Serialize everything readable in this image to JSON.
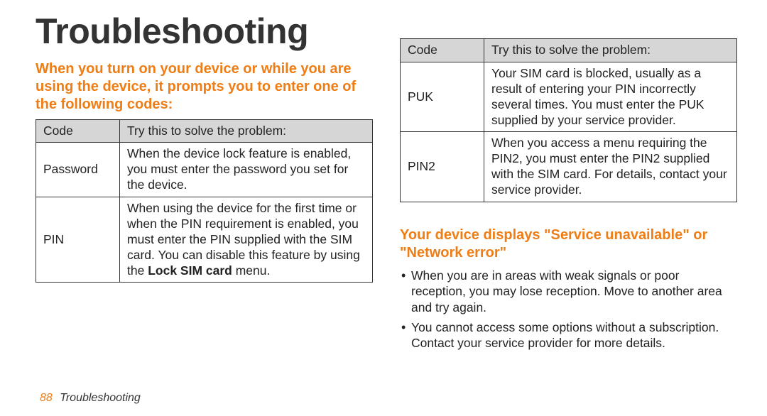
{
  "title": "Troubleshooting",
  "heading1": "When you turn on your device or while you are using the device, it prompts you to enter one of the following codes:",
  "table_header": {
    "c1": "Code",
    "c2": "Try this to solve the problem:"
  },
  "table_left": [
    {
      "code": "Password",
      "solution_plain": "When the device lock feature is enabled, you must enter the password you set for the device."
    },
    {
      "code": "PIN",
      "solution_prefix": "When using the device for the first time or when the PIN requirement is enabled, you must enter the PIN supplied with the SIM card. You can disable this feature by using the ",
      "solution_bold": "Lock SIM card",
      "solution_suffix": " menu."
    }
  ],
  "table_right": [
    {
      "code": "PUK",
      "solution_plain": "Your SIM card is blocked, usually as a result of entering your PIN incorrectly several times. You must enter the PUK supplied by your service provider."
    },
    {
      "code": "PIN2",
      "solution_plain": "When you access a menu requiring the PIN2, you must enter the PIN2 supplied with the SIM card. For details, contact your service provider."
    }
  ],
  "heading2": "Your device displays \"Service unavailable\" or \"Network error\"",
  "bullets": [
    "When you are in areas with weak signals or poor reception, you may lose reception. Move to another area and try again.",
    "You cannot access some options without a subscription. Contact your service provider for more details."
  ],
  "footer": {
    "page_number": "88",
    "section": "Troubleshooting"
  }
}
